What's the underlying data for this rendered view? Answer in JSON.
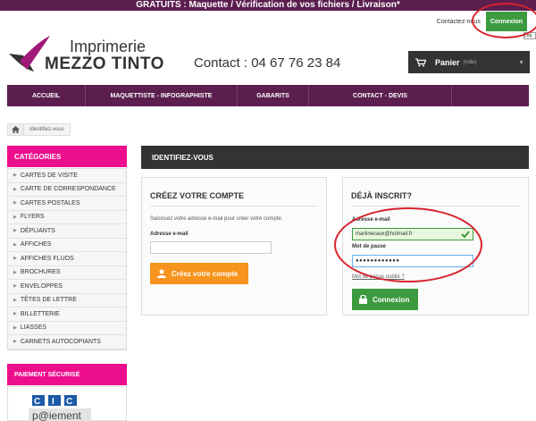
{
  "topbar": {
    "text": "GRATUITS : Maquette / Vérification de vos fichiers / Livraison*"
  },
  "toplinks": {
    "contact": "Contactez-nous",
    "login": "Connexion",
    "tooltip": "Log"
  },
  "logo": {
    "line1": "Imprimerie",
    "line2": "MEZZO TINTO"
  },
  "contact": {
    "text": "Contact : 04 67 76 23 84"
  },
  "cart": {
    "label": "Panier",
    "status": "(vide)"
  },
  "nav": {
    "items": [
      "Accueil",
      "Maquettiste - Infographiste",
      "Gabarits",
      "Contact - Devis"
    ]
  },
  "breadcrumb": {
    "current": "Identifiez-vous"
  },
  "sidebar": {
    "title": "CATÉGORIES",
    "items": [
      "Cartes de visite",
      "Carte de correspondance",
      "Cartes postales",
      "Flyers",
      "Dépliants",
      "Affiches",
      "Affiches fluos",
      "Brochures",
      "Enveloppes",
      "Têtes de lettre",
      "Billetterie",
      "Liasses",
      "Carnets autocopiants"
    ]
  },
  "payment": {
    "title": "PAIEMENT SÉCURISÉ",
    "cic": "CIC",
    "paiement": "p@iement"
  },
  "main": {
    "title": "Identifiez-vous"
  },
  "create": {
    "title": "Créez votre compte",
    "desc": "Saisissez votre adresse e-mail pour créer votre compte.",
    "email_label": "Adresse e-mail",
    "email_value": "",
    "button": "Créez votre compte"
  },
  "login": {
    "title": "Déjà inscrit?",
    "email_label": "Adresse e-mail",
    "email_value": "martinecaux@hotmail.fr",
    "password_label": "Mot de passe",
    "password_value": "●●●●●●●●●●●●",
    "forgot": "Mot de passe oublié ?",
    "button": "Connexion"
  },
  "colors": {
    "brand": "#5b1e4f",
    "pink": "#ec0e8c",
    "green": "#3c9a3f",
    "orange": "#f7941e",
    "annotation": "#d7232c"
  }
}
